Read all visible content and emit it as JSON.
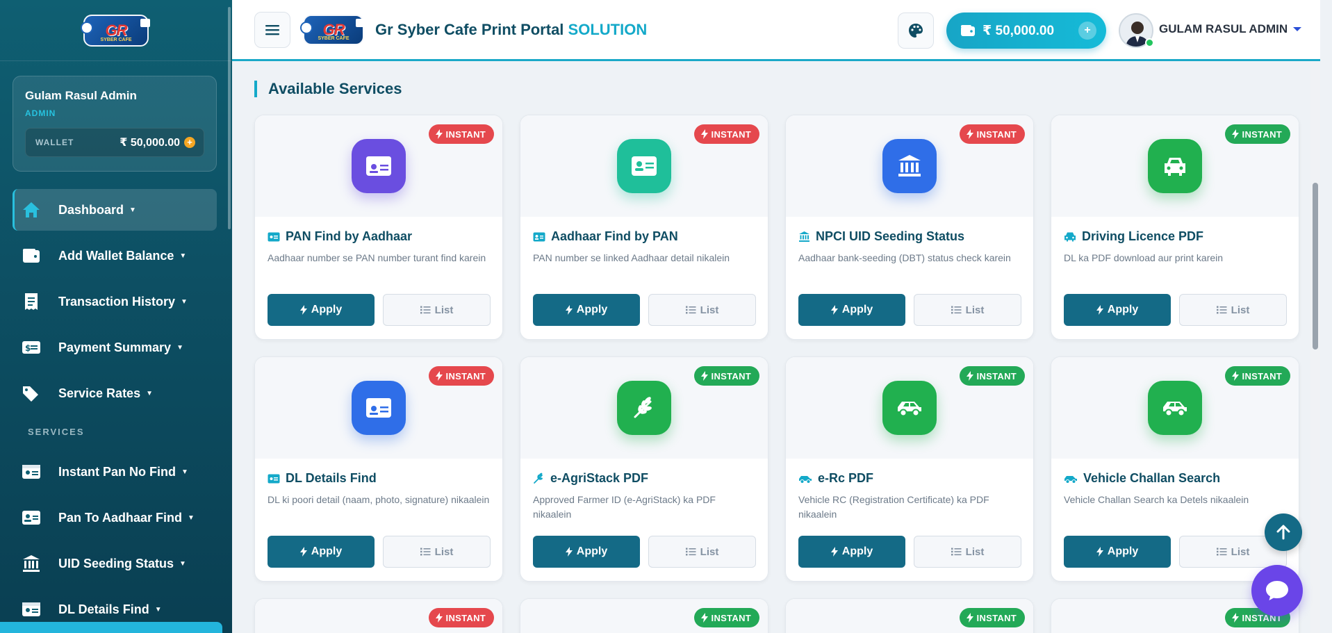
{
  "brand": {
    "logo_text": "GR",
    "logo_sub": "SYBER CAFE"
  },
  "sidebar": {
    "user": {
      "name": "Gulam Rasul Admin",
      "role": "ADMIN",
      "wallet_label": "WALLET",
      "wallet_value": "₹ 50,000.00"
    },
    "menu": [
      {
        "label": "Dashboard",
        "icon": "home-icon",
        "active": true
      },
      {
        "label": "Add Wallet Balance",
        "icon": "wallet-icon"
      },
      {
        "label": "Transaction History",
        "icon": "receipt-icon"
      },
      {
        "label": "Payment Summary",
        "icon": "money-icon"
      },
      {
        "label": "Service Rates",
        "icon": "tags-icon"
      }
    ],
    "section_title": "SERVICES",
    "services_menu": [
      {
        "label": "Instant Pan No Find",
        "icon": "id-card-icon"
      },
      {
        "label": "Pan To Aadhaar Find",
        "icon": "id-card-alt-icon"
      },
      {
        "label": "UID Seeding Status",
        "icon": "bank-icon"
      },
      {
        "label": "DL Details Find",
        "icon": "id-card-icon"
      }
    ]
  },
  "header": {
    "title_main": "Gr Syber Cafe Print Portal",
    "title_accent": "SOLUTION",
    "wallet": "₹ 50,000.00",
    "user": "GULAM RASUL ADMIN"
  },
  "main": {
    "section_title": "Available Services",
    "apply_label": "Apply",
    "list_label": "List",
    "badge_label": "INSTANT",
    "cards": [
      {
        "title": "PAN Find by Aadhaar",
        "desc": "Aadhaar number se PAN number turant find karein",
        "badge": "red",
        "icon_color": "#6a4ee0",
        "icon": "id-card-icon"
      },
      {
        "title": "Aadhaar Find by PAN",
        "desc": "PAN number se linked Aadhaar detail nikalein",
        "badge": "red",
        "icon_color": "#1fbf9a",
        "icon": "id-card-alt-icon"
      },
      {
        "title": "NPCI UID Seeding Status",
        "desc": "Aadhaar bank-seeding (DBT) status check karein",
        "badge": "red",
        "icon_color": "#2f6ee8",
        "icon": "bank-icon"
      },
      {
        "title": "Driving Licence PDF",
        "desc": "DL ka PDF download aur print karein",
        "badge": "green",
        "icon_color": "#21b04f",
        "icon": "car-icon"
      },
      {
        "title": "DL Details Find",
        "desc": "DL ki poori detail (naam, photo, signature) nikaalein",
        "badge": "red",
        "icon_color": "#2f6ee8",
        "icon": "id-card-icon"
      },
      {
        "title": "e-AgriStack PDF",
        "desc": "Approved Farmer ID (e-AgriStack) ka PDF nikaalein",
        "badge": "green",
        "icon_color": "#21b04f",
        "icon": "wheat-icon"
      },
      {
        "title": "e-Rc PDF",
        "desc": "Vehicle RC (Registration Certificate) ka PDF nikaalein",
        "badge": "green",
        "icon_color": "#21b04f",
        "icon": "car-side-icon"
      },
      {
        "title": "Vehicle Challan Search",
        "desc": "Vehicle Challan Search ka Detels nikaalein",
        "badge": "green",
        "icon_color": "#21b04f",
        "icon": "car-side-icon"
      }
    ],
    "row3_badges": [
      "red",
      "green",
      "green",
      "green"
    ]
  }
}
